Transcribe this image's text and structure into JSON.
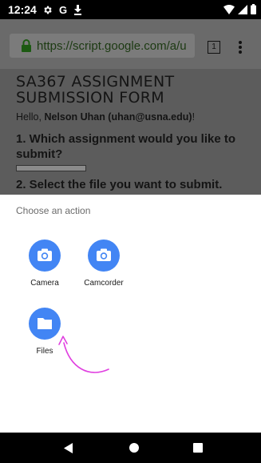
{
  "status": {
    "time": "12:24",
    "g_label": "G"
  },
  "browser": {
    "url": "https://script.google.com/a/u",
    "tab_count": "1"
  },
  "page": {
    "title_line1": "SA367 ASSIGNMENT",
    "title_line2": "SUBMISSION FORM",
    "hello_prefix": "Hello, ",
    "hello_name": "Nelson Uhan (uhan@usna.edu)",
    "hello_suffix": "!",
    "question1": "1. Which assignment would you like to submit?",
    "question2": "2. Select the file you want to submit."
  },
  "sheet": {
    "title": "Choose an action",
    "actions": [
      {
        "label": "Camera",
        "icon": "camera-icon"
      },
      {
        "label": "Camcorder",
        "icon": "camcorder-icon"
      },
      {
        "label": "Files",
        "icon": "folder-icon"
      }
    ]
  },
  "colors": {
    "accent": "#4285f4",
    "annotation": "#e040e0"
  }
}
